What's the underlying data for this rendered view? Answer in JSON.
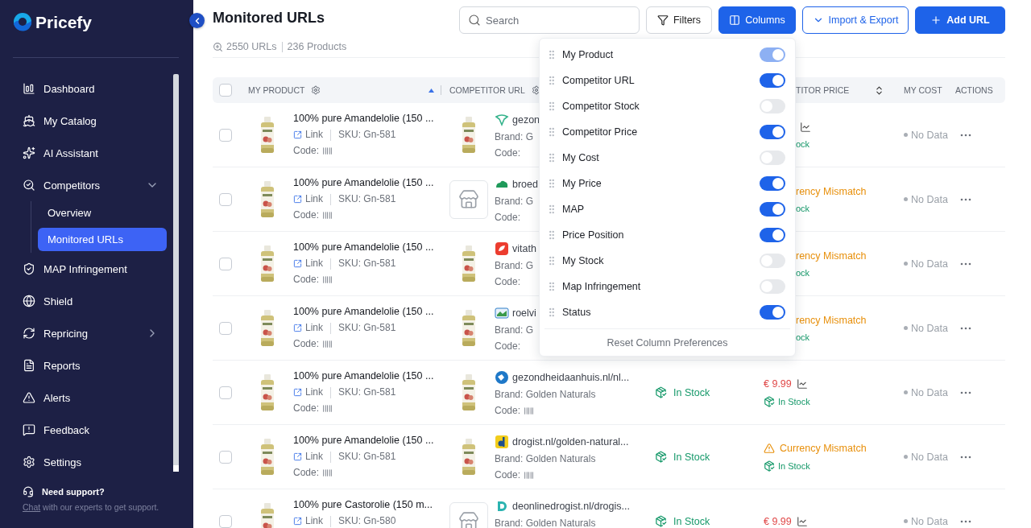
{
  "brand": {
    "name": "Pricefy"
  },
  "sidebar": {
    "items": [
      {
        "label": "Dashboard",
        "selected": false
      },
      {
        "label": "My Catalog",
        "selected": false
      },
      {
        "label": "AI Assistant",
        "selected": false
      },
      {
        "label": "Competitors",
        "selected": false,
        "expanded": true,
        "children": [
          {
            "label": "Overview",
            "selected": false
          },
          {
            "label": "Monitored URLs",
            "selected": true
          }
        ]
      },
      {
        "label": "MAP Infringement",
        "selected": false
      },
      {
        "label": "Shield",
        "selected": false
      },
      {
        "label": "Repricing",
        "selected": false,
        "expanded": false
      },
      {
        "label": "Reports",
        "selected": false
      },
      {
        "label": "Alerts",
        "selected": false
      },
      {
        "label": "Feedback",
        "selected": false
      },
      {
        "label": "Settings",
        "selected": false
      }
    ],
    "support": {
      "title": "Need support?",
      "link": "Chat",
      "text": " with our experts to get support."
    }
  },
  "page": {
    "title": "Monitored URLs",
    "urls": "2550 URLs",
    "products": "236 Products"
  },
  "toolbar": {
    "search": {
      "placeholder": "Search"
    },
    "buttons": [
      {
        "label": "Filters",
        "kind": "filter",
        "selected": false
      },
      {
        "label": "Columns",
        "kind": "columns",
        "selected": true
      },
      {
        "label": "Import & Export",
        "kind": "export",
        "selected": false
      },
      {
        "label": "Add URL",
        "kind": "add",
        "selected": false
      }
    ]
  },
  "columns_menu": {
    "items": [
      {
        "label": "My Product",
        "on": true,
        "disabled": true
      },
      {
        "label": "Competitor URL",
        "on": true,
        "disabled": false
      },
      {
        "label": "Competitor Stock",
        "on": false,
        "disabled": false
      },
      {
        "label": "Competitor Price",
        "on": true,
        "disabled": false
      },
      {
        "label": "My Cost",
        "on": false,
        "disabled": false
      },
      {
        "label": "My Price",
        "on": true,
        "disabled": false
      },
      {
        "label": "MAP",
        "on": true,
        "disabled": false
      },
      {
        "label": "Price Position",
        "on": true,
        "disabled": false
      },
      {
        "label": "My Stock",
        "on": false,
        "disabled": false
      },
      {
        "label": "Map Infringement",
        "on": false,
        "disabled": false
      },
      {
        "label": "Status",
        "on": true,
        "disabled": false
      }
    ],
    "reset": "Reset Column Preferences"
  },
  "table": {
    "header": {
      "checked": false
    },
    "columns": [
      {
        "label": "MY PRODUCT",
        "kind": "product"
      },
      {
        "label": "COMPETITOR URL",
        "kind": "competitor"
      },
      {
        "label": "TITOR PRICE",
        "kind": "price",
        "under_menu": true
      },
      {
        "label": "MY COST",
        "kind": "cost"
      },
      {
        "label": "ACTIONS",
        "kind": "actions"
      }
    ],
    "rows": [
      {
        "checked": false,
        "under_menu": true,
        "product": {
          "title": "100% pure Amandelolie (150 ...",
          "link": "Link",
          "sku": "SKU: Gn-581",
          "code": "Code:"
        },
        "competitor": {
          "kind": "picture",
          "url": "gezon",
          "brand": "Brand: G",
          "code": "Code:"
        },
        "price": {
          "kind": "price",
          "stock": "ock"
        },
        "cost": "No Data"
      },
      {
        "checked": false,
        "under_menu": true,
        "product": {
          "title": "100% pure Amandelolie (150 ...",
          "link": "Link",
          "sku": "SKU: Gn-581",
          "code": "Code:"
        },
        "competitor": {
          "kind": "store",
          "url": "broed",
          "brand": "Brand: G",
          "code": "Code:"
        },
        "price": {
          "kind": "mismatch",
          "text": "rency Mismatch",
          "stock": "ock"
        },
        "cost": "No Data"
      },
      {
        "checked": false,
        "under_menu": true,
        "product": {
          "title": "100% pure Amandelolie (150 ...",
          "link": "Link",
          "sku": "SKU: Gn-581",
          "code": "Code:"
        },
        "competitor": {
          "kind": "picture",
          "url": "vitath",
          "brand": "Brand: G",
          "code": "Code:"
        },
        "price": {
          "kind": "mismatch",
          "text": "rency Mismatch",
          "stock": "ock"
        },
        "cost": "No Data"
      },
      {
        "checked": false,
        "under_menu": true,
        "product": {
          "title": "100% pure Amandelolie (150 ...",
          "link": "Link",
          "sku": "SKU: Gn-581",
          "code": "Code:"
        },
        "competitor": {
          "kind": "picture",
          "url": "roelvi",
          "brand": "Brand: G",
          "code": "Code:"
        },
        "price": {
          "kind": "mismatch",
          "text": "rency Mismatch",
          "stock": "ock"
        },
        "cost": "No Data"
      },
      {
        "checked": false,
        "product": {
          "title": "100% pure Amandelolie (150 ...",
          "link": "Link",
          "sku": "SKU: Gn-581",
          "code": "Code:"
        },
        "competitor": {
          "kind": "picture",
          "url": "gezondheidaanhuis.nl/nl...",
          "brand": "Brand: Golden Naturals",
          "code": "Code:"
        },
        "stock": "In Stock",
        "price": {
          "kind": "price",
          "text": "€ 9.99",
          "stock": "In Stock"
        },
        "cost": "No Data"
      },
      {
        "checked": false,
        "product": {
          "title": "100% pure Amandelolie (150 ...",
          "link": "Link",
          "sku": "SKU: Gn-581",
          "code": "Code:"
        },
        "competitor": {
          "kind": "picture",
          "url": "drogist.nl/golden-natural...",
          "brand": "Brand: Golden Naturals",
          "code": "Code:"
        },
        "stock": "In Stock",
        "price": {
          "kind": "mismatch",
          "text": "Currency Mismatch",
          "stock": "In Stock"
        },
        "cost": "No Data"
      },
      {
        "checked": false,
        "product": {
          "title": "100% pure Castorolie (150 m...",
          "link": "Link",
          "sku": "SKU: Gn-580"
        },
        "competitor": {
          "kind": "store",
          "url": "deonlinedrogist.nl/drogis...",
          "brand": "Brand: Golden Naturals"
        },
        "stock": "In Stock",
        "price": {
          "kind": "price",
          "text": "€ 9.99"
        },
        "cost": "No Data"
      }
    ]
  }
}
